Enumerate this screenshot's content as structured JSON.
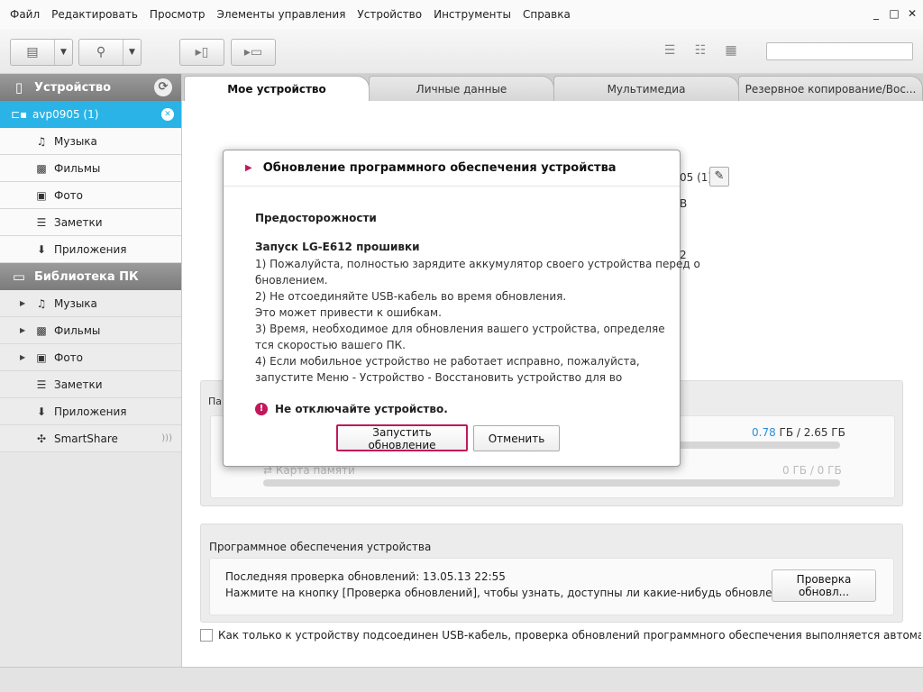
{
  "menu": [
    "Файл",
    "Редактировать",
    "Просмотр",
    "Элементы управления",
    "Устройство",
    "Инструменты",
    "Справка"
  ],
  "window_controls": {
    "minimize": "_",
    "maximize": "□",
    "close": "✕"
  },
  "toolbar": {
    "search_placeholder": ""
  },
  "sidebar": {
    "device_header": "Устройство",
    "device_name": "avp0905 (1)",
    "device_items": [
      "Музыка",
      "Фильмы",
      "Фото",
      "Заметки",
      "Приложения"
    ],
    "library_header": "Библиотека ПК",
    "library_items": [
      "Музыка",
      "Фильмы",
      "Фото",
      "Заметки",
      "Приложения",
      "SmartShare"
    ]
  },
  "tabs": [
    "Мое устройство",
    "Личные данные",
    "Мультимедиа",
    "Резервное копирование/Вос..."
  ],
  "main": {
    "device_label_fragment": "05 (1)",
    "info_fragment_1": "B",
    "info_fragment_2": "2",
    "memory_panel_fragment": "Па",
    "internal_used": "0.78",
    "internal_total": "ГБ / 2.65 ГБ",
    "internal_fraction": 0.29,
    "card_label": "Карта памяти",
    "card_usage": "0 ГБ / 0 ГБ",
    "card_fraction": 0.0,
    "software_title": "Программное обеспечения устройства",
    "last_check": "Последняя проверка обновлений: 13.05.13 22:55",
    "hint": "Нажмите на кнопку [Проверка обновлений], чтобы узнать, доступны ли какие-нибудь обновления.",
    "check_button": "Проверка обновл...",
    "auto_check_label": "Как только к устройству подсоединен USB-кабель, проверка обновлений программного обеспечения выполняется автоматиче"
  },
  "dialog": {
    "title": "Обновление программного обеспечения устройства",
    "caution": "Предосторожности",
    "start_title": "Запуск LG-E612 прошивки",
    "lines": [
      "1) Пожалуйста, полностью зарядите аккумулятор своего устройства перед о",
      "бновлением.",
      "2) Не отсоединяйте USB-кабель во время обновления.",
      "Это может привести к ошибкам.",
      "3) Время, необходимое для обновления вашего устройства, определяе",
      "тся скоростью вашего ПК.",
      "4) Если мобильное устройство не работает исправно, пожалуйста,",
      "запустите Меню - Устройство - Восстановить устройство для во"
    ],
    "warning": "Не отключайте устройство.",
    "start_button": "Запустить обновление",
    "cancel_button": "Отменить"
  },
  "colors": {
    "accent": "#2ab3e6",
    "highlight": "#c2185b",
    "used_value": "#2a8fd8"
  }
}
